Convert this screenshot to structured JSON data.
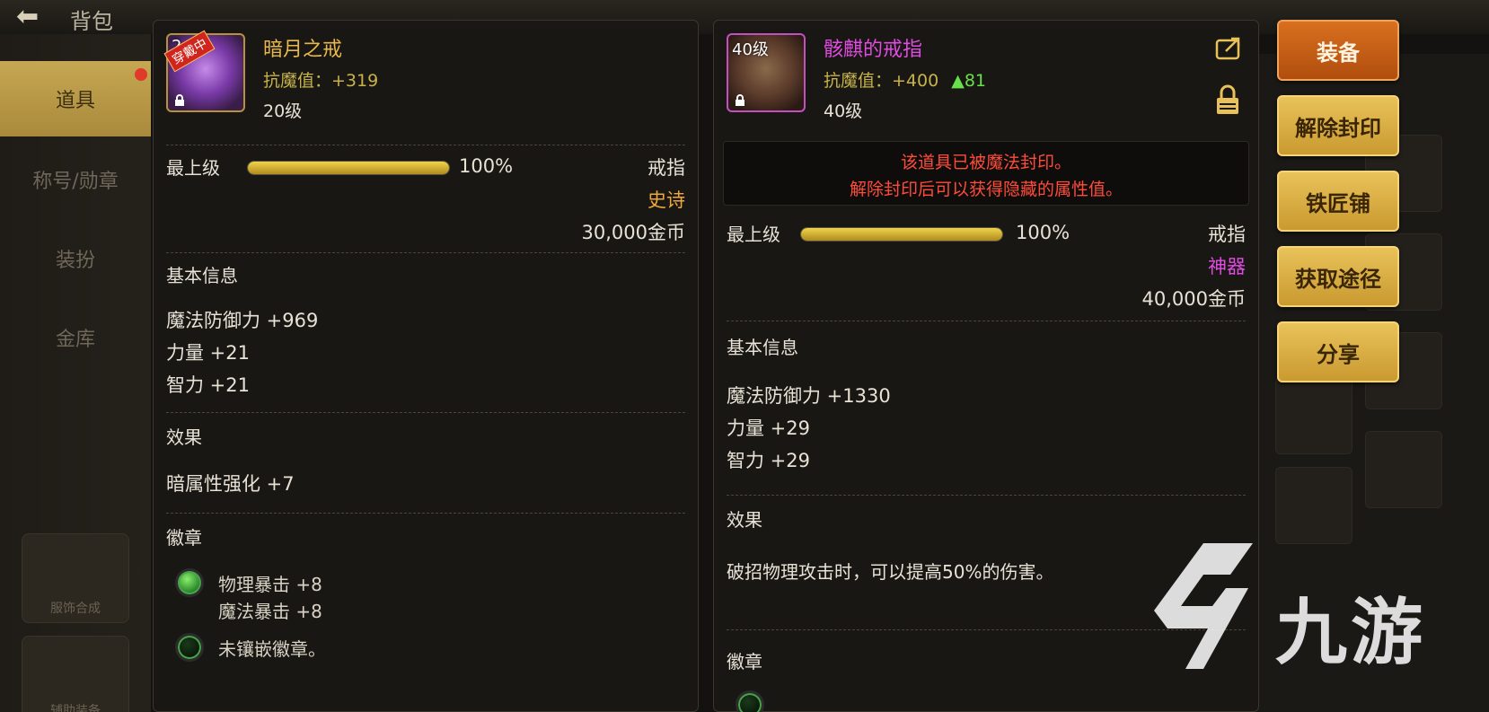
{
  "topbar": {
    "title": "背包"
  },
  "sidebar": {
    "items": [
      {
        "label": "道具",
        "active": true
      },
      {
        "label": "称号/勋章",
        "active": false
      },
      {
        "label": "装扮",
        "active": false
      },
      {
        "label": "金库",
        "active": false
      }
    ],
    "bottom_items": [
      "服饰合成",
      "辅助装备"
    ]
  },
  "left_card": {
    "icon": {
      "level": "2",
      "badge": "穿戴中",
      "name": "ring-purple-icon"
    },
    "name": "暗月之戒",
    "name_color": "#e8b84a",
    "stat": "抗魔值：+319",
    "level": "20级",
    "grade": {
      "label": "最上级",
      "percent": 100,
      "percent_text": "100%"
    },
    "type": "戒指",
    "rarity": "史诗",
    "rarity_color": "#f0a83a",
    "price": "30,000金币",
    "basic_title": "基本信息",
    "basic_attrs": [
      "魔法防御力 +969",
      "力量 +21",
      "智力 +21"
    ],
    "effect_title": "效果",
    "effects": [
      "暗属性强化 +7"
    ],
    "emblem_title": "徽章",
    "emblems": [
      {
        "lines": [
          "物理暴击 +8",
          "魔法暴击 +8"
        ],
        "filled": true
      },
      {
        "lines": [
          "未镶嵌徽章。"
        ],
        "filled": false
      }
    ]
  },
  "right_card": {
    "icon": {
      "level": "40级",
      "name": "ring-claw-icon"
    },
    "name": "骸麒的戒指",
    "name_color": "#e04be0",
    "stat": "抗魔值：+400",
    "stat_up": "▲81",
    "level": "40级",
    "seal_message": [
      "该道具已被魔法封印。",
      "解除封印后可以获得隐藏的属性值。"
    ],
    "grade": {
      "label": "最上级",
      "percent": 100,
      "percent_text": "100%"
    },
    "type": "戒指",
    "rarity": "神器",
    "rarity_color": "#e04be0",
    "price": "40,000金币",
    "basic_title": "基本信息",
    "basic_attrs": [
      "魔法防御力 +1330",
      "力量 +29",
      "智力 +29"
    ],
    "effect_title": "效果",
    "effects": [
      "破招物理攻击时，可以提高50%的伤害。"
    ],
    "emblem_title": "徽章"
  },
  "actions": {
    "equip": "装备",
    "unseal": "解除封印",
    "blacksmith": "铁匠铺",
    "obtain": "获取途径",
    "share": "分享"
  },
  "watermark": {
    "text": "九游"
  }
}
